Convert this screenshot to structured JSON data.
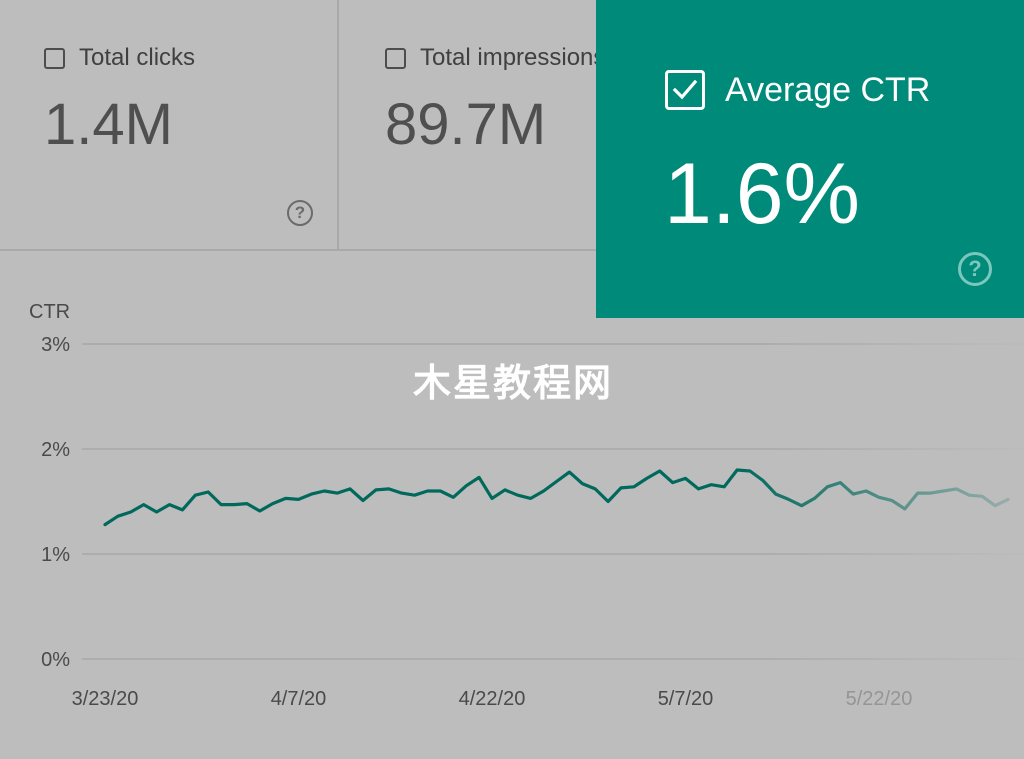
{
  "cards": {
    "clicks": {
      "label": "Total clicks",
      "value": "1.4M",
      "checked": false
    },
    "impressions": {
      "label": "Total impressions",
      "value": "89.7M",
      "checked": false
    },
    "ctr": {
      "label": "Average CTR",
      "value": "1.6%",
      "checked": true
    }
  },
  "watermark": "木星教程网",
  "colors": {
    "background": "#bdbdbd",
    "ctr_card": "#008a79",
    "line": "#00695c"
  },
  "icons": {
    "help": "help-circle-icon",
    "check": "check-icon"
  },
  "chart_data": {
    "type": "line",
    "ylabel": "CTR",
    "ylim": [
      0,
      3
    ],
    "y_ticks": [
      0,
      1,
      2,
      3
    ],
    "y_tick_labels": [
      "0%",
      "1%",
      "2%",
      "3%"
    ],
    "x_tick_labels": [
      "3/23/20",
      "4/7/20",
      "4/22/20",
      "5/7/20",
      "5/22/20"
    ],
    "x_tick_index": [
      0,
      15,
      30,
      45,
      60
    ],
    "grid": true,
    "series": [
      {
        "values": [
          1.28,
          1.36,
          1.4,
          1.47,
          1.4,
          1.47,
          1.42,
          1.56,
          1.59,
          1.47,
          1.47,
          1.48,
          1.41,
          1.48,
          1.53,
          1.52,
          1.57,
          1.6,
          1.58,
          1.62,
          1.51,
          1.61,
          1.62,
          1.58,
          1.56,
          1.6,
          1.6,
          1.54,
          1.65,
          1.73,
          1.53,
          1.61,
          1.56,
          1.53,
          1.6,
          1.69,
          1.78,
          1.67,
          1.62,
          1.5,
          1.63,
          1.64,
          1.72,
          1.79,
          1.68,
          1.72,
          1.62,
          1.66,
          1.64,
          1.8,
          1.79,
          1.7,
          1.57,
          1.52,
          1.46,
          1.53,
          1.64,
          1.68,
          1.57,
          1.6,
          1.54,
          1.51,
          1.43,
          1.58,
          1.58,
          1.6,
          1.62,
          1.56,
          1.55,
          1.46,
          1.52
        ]
      }
    ]
  }
}
